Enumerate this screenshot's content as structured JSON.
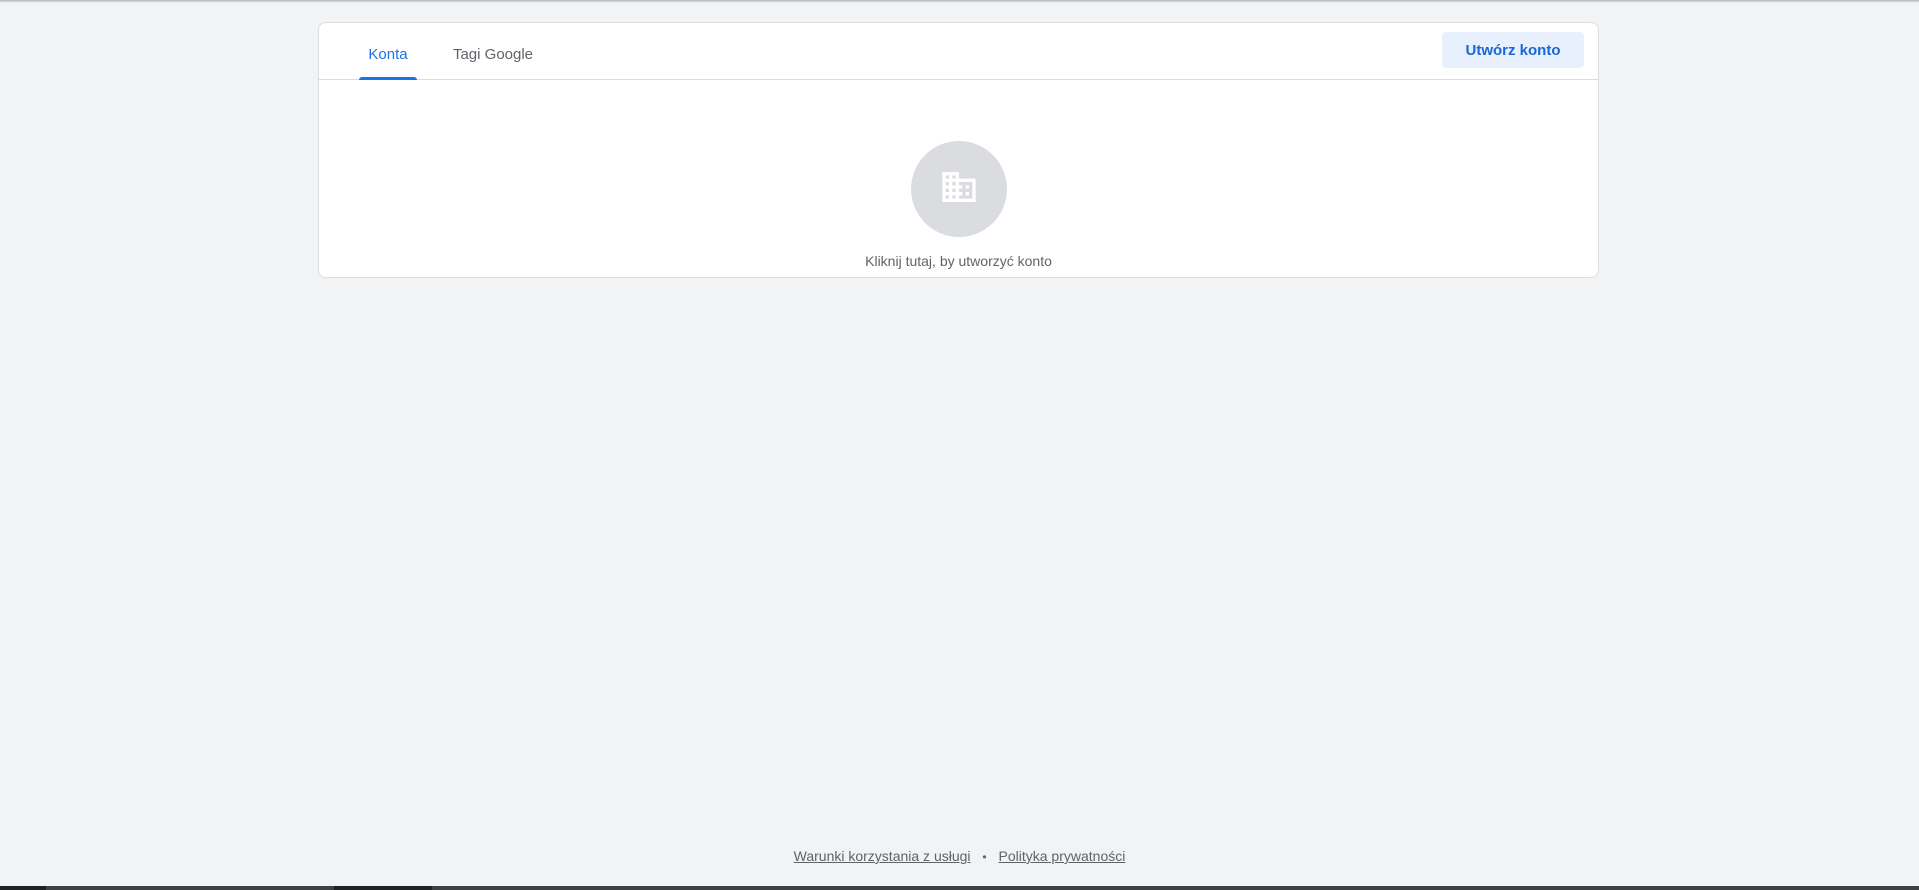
{
  "tabs": [
    {
      "label": "Konta",
      "active": true
    },
    {
      "label": "Tagi Google",
      "active": false
    }
  ],
  "header": {
    "create_button_label": "Utwórz konto"
  },
  "empty_state": {
    "icon": "domain-building-icon",
    "message": "Kliknij tutaj, by utworzyć konto"
  },
  "footer": {
    "terms_label": "Warunki korzystania z usługi",
    "separator": "•",
    "privacy_label": "Polityka prywatności"
  },
  "colors": {
    "accent": "#1a73e8",
    "button_bg": "#e8f0fe",
    "button_text": "#1967d2",
    "page_bg": "#f1f3f4",
    "icon_circle": "#dadce0"
  }
}
